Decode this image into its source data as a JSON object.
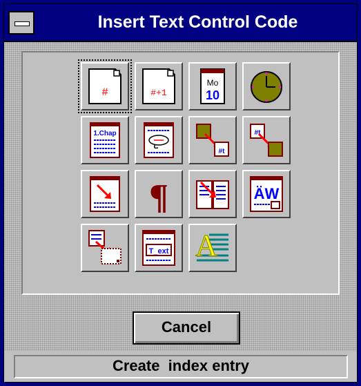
{
  "window": {
    "title": "Insert Text Control Code"
  },
  "tools": [
    {
      "icon": "page-number-icon",
      "glyph": "#"
    },
    {
      "icon": "next-page-number-icon",
      "glyph": "#+1"
    },
    {
      "icon": "date-icon",
      "glyph_top": "Mo",
      "glyph_bottom": "10"
    },
    {
      "icon": "time-icon"
    },
    {
      "icon": "chapter-icon",
      "glyph": "1.Chap"
    },
    {
      "icon": "footnote-icon"
    },
    {
      "icon": "cross-reference-target-icon",
      "glyph": "#t"
    },
    {
      "icon": "cross-reference-source-icon",
      "glyph": "#t"
    },
    {
      "icon": "index-entry-icon"
    },
    {
      "icon": "paragraph-mark-icon",
      "glyph": "¶"
    },
    {
      "icon": "table-of-contents-icon"
    },
    {
      "icon": "autotext-icon",
      "glyph": "ÄW"
    },
    {
      "icon": "merge-field-icon"
    },
    {
      "icon": "text-field-icon",
      "glyph": "T_ext"
    },
    {
      "icon": "drop-cap-icon",
      "glyph": "A"
    }
  ],
  "buttons": {
    "cancel": "Cancel"
  },
  "status": {
    "text": "Create  index entry"
  },
  "colors": {
    "titlebar": "#000080",
    "face": "#c0c0c0",
    "accent_red": "#ff0000",
    "accent_blue": "#0000ff",
    "dark_red": "#800000",
    "olive": "#808000"
  }
}
